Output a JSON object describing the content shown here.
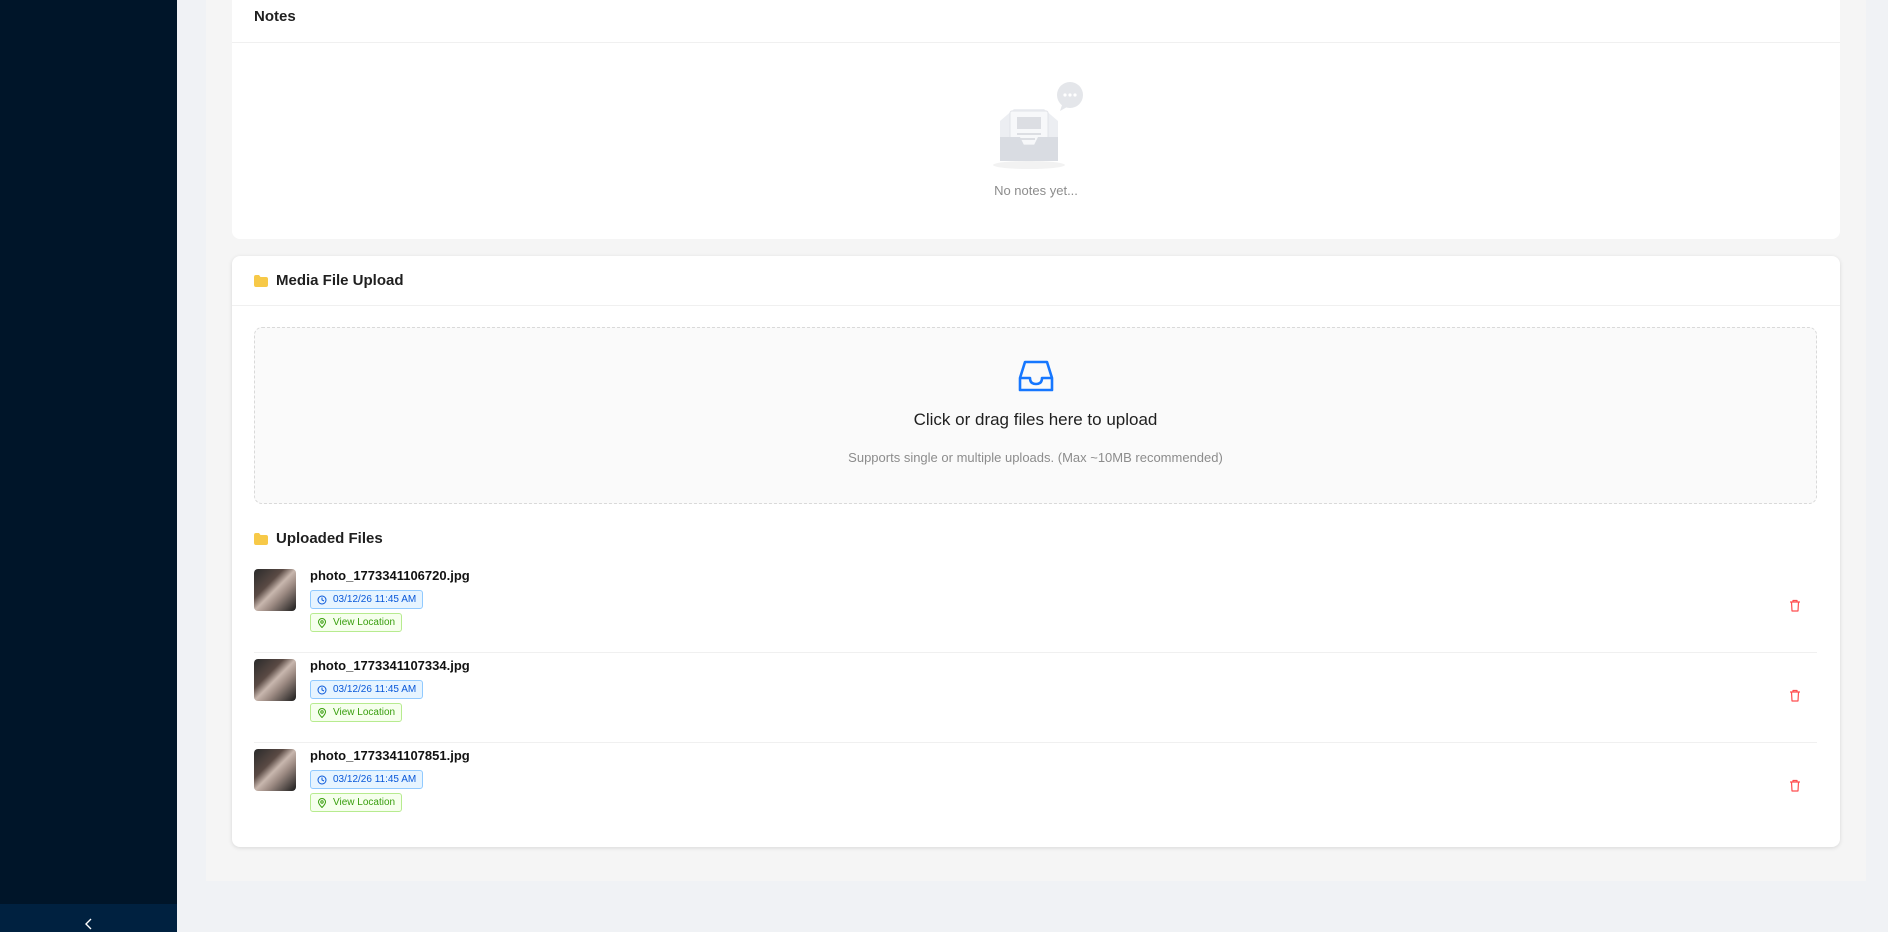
{
  "notes": {
    "title": "Notes",
    "empty_text": "No notes yet..."
  },
  "media": {
    "title": "Media File Upload",
    "dropzone_title": "Click or drag files here to upload",
    "dropzone_hint": "Supports single or multiple uploads. (Max ~10MB recommended)",
    "uploaded_title": "Uploaded Files",
    "files": [
      {
        "name": "photo_1773341106720.jpg",
        "time": "03/12/26 11:45 AM",
        "location_label": "View Location"
      },
      {
        "name": "photo_1773341107334.jpg",
        "time": "03/12/26 11:45 AM",
        "location_label": "View Location"
      },
      {
        "name": "photo_1773341107851.jpg",
        "time": "03/12/26 11:45 AM",
        "location_label": "View Location"
      }
    ]
  },
  "icons": {
    "collapse": "chevron-left-icon",
    "folder": "folder-icon",
    "inbox": "inbox-icon",
    "clock": "clock-icon",
    "location": "map-pin-icon",
    "delete": "trash-icon"
  },
  "colors": {
    "sider": "#001529",
    "primary": "#1677ff",
    "danger": "#ff4d4f",
    "folder": "#f7c948"
  }
}
